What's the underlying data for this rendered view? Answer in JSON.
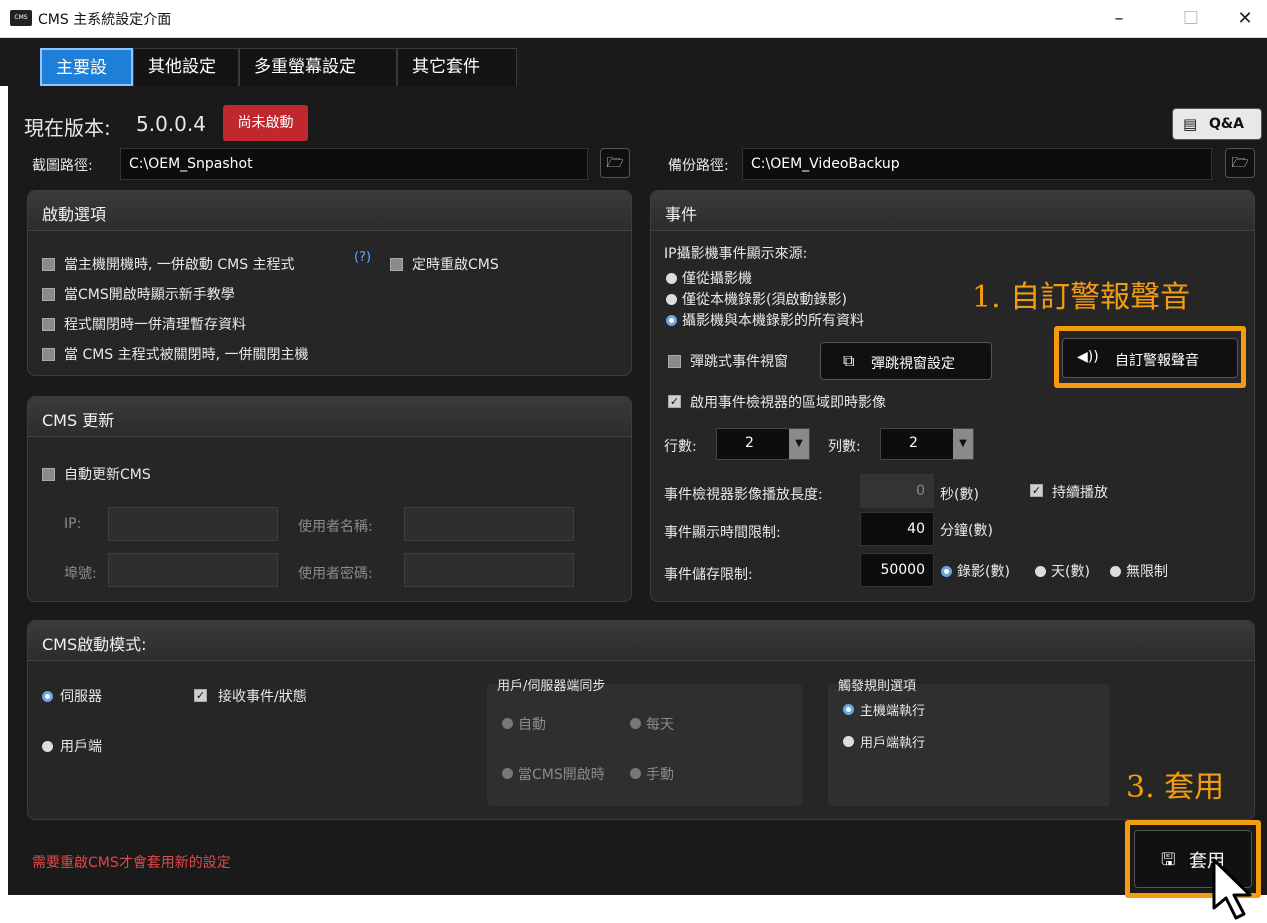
{
  "window": {
    "title": "CMS 主系統設定介面",
    "app_icon": "cms-app-icon",
    "minimize": "–",
    "maximize": "☐",
    "close": "✕"
  },
  "tabs": [
    {
      "label": "主要設定",
      "active": true
    },
    {
      "label": "其他設定",
      "active": false
    },
    {
      "label": "多重螢幕設定",
      "active": false
    },
    {
      "label": "其它套件",
      "active": false
    }
  ],
  "header": {
    "version_label": "現在版本:",
    "version": "5.0.0.4",
    "status_badge": "尚未啟動",
    "qa_label": "Q&A"
  },
  "paths": {
    "snapshot_label": "截圖路徑:",
    "snapshot_value": "C:\\OEM_Snpashot",
    "backup_label": "備份路徑:",
    "backup_value": "C:\\OEM_VideoBackup"
  },
  "startup": {
    "title": "啟動選項",
    "opt_autostart": "當主機開機時, 一併啟動 CMS 主程式",
    "help": "(?)",
    "opt_scheduled_restart": "定時重啟CMS",
    "opt_tutorial": "當CMS開啟時顯示新手教學",
    "opt_cleanup": "程式關閉時一併清理暫存資料",
    "opt_shutdown": "當 CMS 主程式被關閉時, 一併關閉主機"
  },
  "update": {
    "title": "CMS 更新",
    "auto_update": "自動更新CMS",
    "ip_label": "IP:",
    "port_label": "埠號:",
    "username_label": "使用者名稱:",
    "password_label": "使用者密碼:"
  },
  "events": {
    "title": "事件",
    "source_label": "IP攝影機事件顯示來源:",
    "source_camera_only": "僅從攝影機",
    "source_local_only": "僅從本機錄影(須啟動錄影)",
    "source_all": "攝影機與本機錄影的所有資料",
    "popup_window": "彈跳式事件視窗",
    "popup_settings": "彈跳視窗設定",
    "custom_alarm_sound": "自訂警報聲音",
    "enable_live_view": "啟用事件檢視器的區域即時影像",
    "rows_label": "行數:",
    "rows_value": "2",
    "cols_label": "列數:",
    "cols_value": "2",
    "playback_length_label": "事件檢視器影像播放長度:",
    "playback_length_value": "0",
    "playback_unit": "秒(數)",
    "continuous_play": "持續播放",
    "display_limit_label": "事件顯示時間限制:",
    "display_limit_value": "40",
    "display_limit_unit": "分鐘(數)",
    "storage_limit_label": "事件儲存限制:",
    "storage_limit_value": "50000",
    "storage_records": "錄影(數)",
    "storage_days": "天(數)",
    "storage_unlimited": "無限制"
  },
  "mode": {
    "title": "CMS啟動模式:",
    "server": "伺服器",
    "client": "用戶端",
    "receive_events": "接收事件/狀態",
    "sync_title": "用戶/伺服器端同步",
    "sync_auto": "自動",
    "sync_daily": "每天",
    "sync_on_open": "當CMS開啟時",
    "sync_manual": "手動",
    "trigger_title": "觸發規則選項",
    "trigger_server": "主機端執行",
    "trigger_client": "用戶端執行"
  },
  "footer": {
    "restart_notice": "需要重啟CMS才會套用新的設定",
    "apply_label": "套用"
  },
  "annotations": {
    "step1": "1. 自訂警報聲音",
    "step3": "3. 套用"
  },
  "colors": {
    "accent_blue": "#1e7fd8",
    "badge_red": "#c0282d",
    "annotation_orange": "#f39c11",
    "notice_red": "#e04848"
  }
}
